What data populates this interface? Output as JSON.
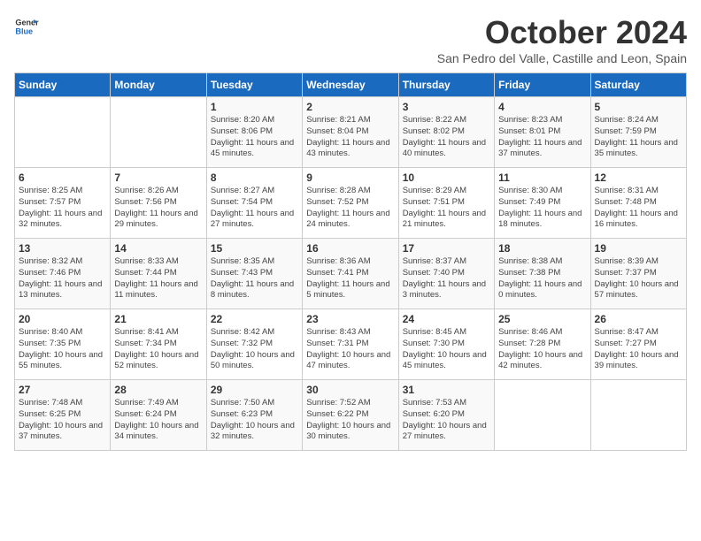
{
  "header": {
    "logo_line1": "General",
    "logo_line2": "Blue",
    "month": "October 2024",
    "location": "San Pedro del Valle, Castille and Leon, Spain"
  },
  "weekdays": [
    "Sunday",
    "Monday",
    "Tuesday",
    "Wednesday",
    "Thursday",
    "Friday",
    "Saturday"
  ],
  "weeks": [
    [
      {
        "day": "",
        "info": ""
      },
      {
        "day": "",
        "info": ""
      },
      {
        "day": "1",
        "info": "Sunrise: 8:20 AM\nSunset: 8:06 PM\nDaylight: 11 hours and 45 minutes."
      },
      {
        "day": "2",
        "info": "Sunrise: 8:21 AM\nSunset: 8:04 PM\nDaylight: 11 hours and 43 minutes."
      },
      {
        "day": "3",
        "info": "Sunrise: 8:22 AM\nSunset: 8:02 PM\nDaylight: 11 hours and 40 minutes."
      },
      {
        "day": "4",
        "info": "Sunrise: 8:23 AM\nSunset: 8:01 PM\nDaylight: 11 hours and 37 minutes."
      },
      {
        "day": "5",
        "info": "Sunrise: 8:24 AM\nSunset: 7:59 PM\nDaylight: 11 hours and 35 minutes."
      }
    ],
    [
      {
        "day": "6",
        "info": "Sunrise: 8:25 AM\nSunset: 7:57 PM\nDaylight: 11 hours and 32 minutes."
      },
      {
        "day": "7",
        "info": "Sunrise: 8:26 AM\nSunset: 7:56 PM\nDaylight: 11 hours and 29 minutes."
      },
      {
        "day": "8",
        "info": "Sunrise: 8:27 AM\nSunset: 7:54 PM\nDaylight: 11 hours and 27 minutes."
      },
      {
        "day": "9",
        "info": "Sunrise: 8:28 AM\nSunset: 7:52 PM\nDaylight: 11 hours and 24 minutes."
      },
      {
        "day": "10",
        "info": "Sunrise: 8:29 AM\nSunset: 7:51 PM\nDaylight: 11 hours and 21 minutes."
      },
      {
        "day": "11",
        "info": "Sunrise: 8:30 AM\nSunset: 7:49 PM\nDaylight: 11 hours and 18 minutes."
      },
      {
        "day": "12",
        "info": "Sunrise: 8:31 AM\nSunset: 7:48 PM\nDaylight: 11 hours and 16 minutes."
      }
    ],
    [
      {
        "day": "13",
        "info": "Sunrise: 8:32 AM\nSunset: 7:46 PM\nDaylight: 11 hours and 13 minutes."
      },
      {
        "day": "14",
        "info": "Sunrise: 8:33 AM\nSunset: 7:44 PM\nDaylight: 11 hours and 11 minutes."
      },
      {
        "day": "15",
        "info": "Sunrise: 8:35 AM\nSunset: 7:43 PM\nDaylight: 11 hours and 8 minutes."
      },
      {
        "day": "16",
        "info": "Sunrise: 8:36 AM\nSunset: 7:41 PM\nDaylight: 11 hours and 5 minutes."
      },
      {
        "day": "17",
        "info": "Sunrise: 8:37 AM\nSunset: 7:40 PM\nDaylight: 11 hours and 3 minutes."
      },
      {
        "day": "18",
        "info": "Sunrise: 8:38 AM\nSunset: 7:38 PM\nDaylight: 11 hours and 0 minutes."
      },
      {
        "day": "19",
        "info": "Sunrise: 8:39 AM\nSunset: 7:37 PM\nDaylight: 10 hours and 57 minutes."
      }
    ],
    [
      {
        "day": "20",
        "info": "Sunrise: 8:40 AM\nSunset: 7:35 PM\nDaylight: 10 hours and 55 minutes."
      },
      {
        "day": "21",
        "info": "Sunrise: 8:41 AM\nSunset: 7:34 PM\nDaylight: 10 hours and 52 minutes."
      },
      {
        "day": "22",
        "info": "Sunrise: 8:42 AM\nSunset: 7:32 PM\nDaylight: 10 hours and 50 minutes."
      },
      {
        "day": "23",
        "info": "Sunrise: 8:43 AM\nSunset: 7:31 PM\nDaylight: 10 hours and 47 minutes."
      },
      {
        "day": "24",
        "info": "Sunrise: 8:45 AM\nSunset: 7:30 PM\nDaylight: 10 hours and 45 minutes."
      },
      {
        "day": "25",
        "info": "Sunrise: 8:46 AM\nSunset: 7:28 PM\nDaylight: 10 hours and 42 minutes."
      },
      {
        "day": "26",
        "info": "Sunrise: 8:47 AM\nSunset: 7:27 PM\nDaylight: 10 hours and 39 minutes."
      }
    ],
    [
      {
        "day": "27",
        "info": "Sunrise: 7:48 AM\nSunset: 6:25 PM\nDaylight: 10 hours and 37 minutes."
      },
      {
        "day": "28",
        "info": "Sunrise: 7:49 AM\nSunset: 6:24 PM\nDaylight: 10 hours and 34 minutes."
      },
      {
        "day": "29",
        "info": "Sunrise: 7:50 AM\nSunset: 6:23 PM\nDaylight: 10 hours and 32 minutes."
      },
      {
        "day": "30",
        "info": "Sunrise: 7:52 AM\nSunset: 6:22 PM\nDaylight: 10 hours and 30 minutes."
      },
      {
        "day": "31",
        "info": "Sunrise: 7:53 AM\nSunset: 6:20 PM\nDaylight: 10 hours and 27 minutes."
      },
      {
        "day": "",
        "info": ""
      },
      {
        "day": "",
        "info": ""
      }
    ]
  ]
}
